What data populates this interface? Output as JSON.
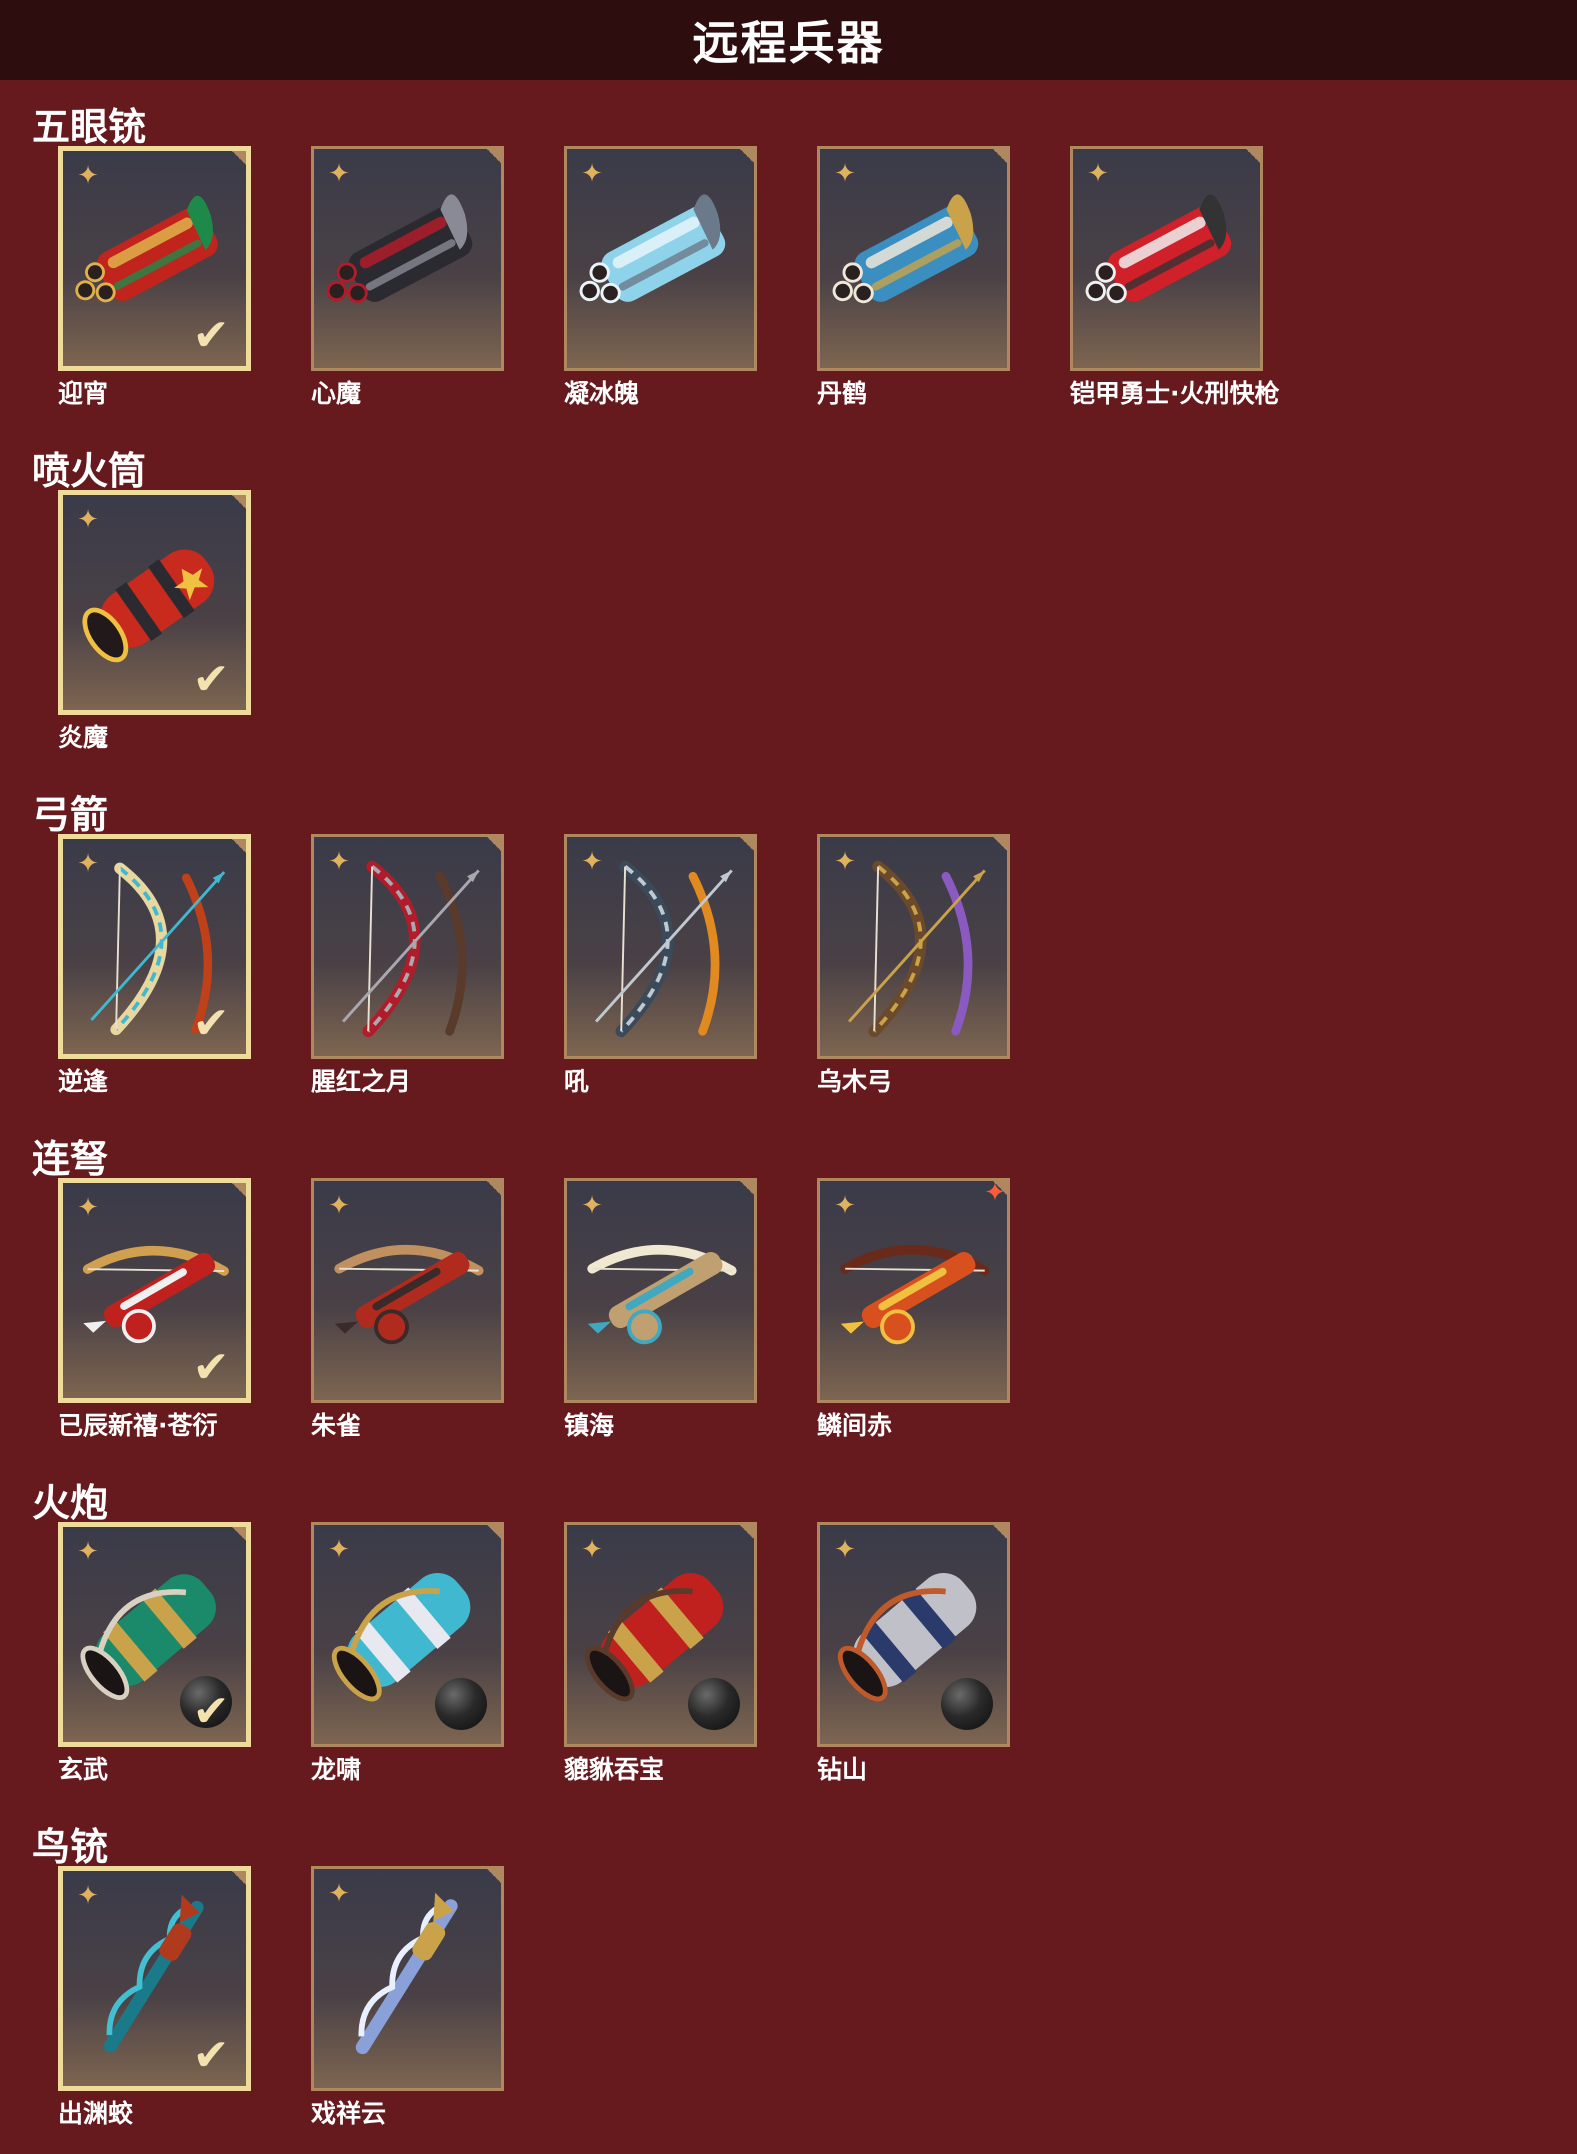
{
  "header": {
    "title": "远程兵器"
  },
  "sections": [
    {
      "title": "五眼铳",
      "items": [
        {
          "name": "迎宵",
          "equipped": true,
          "palette": [
            "#c0241d",
            "#e0b14a",
            "#1d8a4a"
          ],
          "icon": "multi-barrel-gun"
        },
        {
          "name": "心魔",
          "equipped": false,
          "palette": [
            "#2a2a30",
            "#b01c2a",
            "#8a8a96"
          ],
          "icon": "multi-barrel-gun"
        },
        {
          "name": "凝冰魄",
          "equipped": false,
          "palette": [
            "#8fd3ea",
            "#e8f4fa",
            "#6a7a8a"
          ],
          "icon": "multi-barrel-gun"
        },
        {
          "name": "丹鹤",
          "equipped": false,
          "palette": [
            "#3a8fc0",
            "#eee8d8",
            "#c9a24a"
          ],
          "icon": "multi-barrel-gun"
        },
        {
          "name": "铠甲勇士·火刑快枪",
          "equipped": false,
          "palette": [
            "#d0202a",
            "#f0f0f0",
            "#333333"
          ],
          "icon": "multi-barrel-gun"
        }
      ]
    },
    {
      "title": "喷火筒",
      "items": [
        {
          "name": "炎魔",
          "equipped": true,
          "palette": [
            "#c82a1e",
            "#f0c040",
            "#2a2a30"
          ],
          "icon": "flame-tube"
        }
      ]
    },
    {
      "title": "弓箭",
      "items": [
        {
          "name": "逆逢",
          "equipped": true,
          "palette": [
            "#e8d8a0",
            "#40b8d0",
            "#c0401a"
          ],
          "icon": "bow"
        },
        {
          "name": "腥红之月",
          "equipped": false,
          "palette": [
            "#b01c2a",
            "#a8a8b0",
            "#5a3a2a"
          ],
          "icon": "bow"
        },
        {
          "name": "吼",
          "equipped": false,
          "palette": [
            "#3a4a5a",
            "#c0c8d0",
            "#e08a20"
          ],
          "icon": "bow"
        },
        {
          "name": "乌木弓",
          "equipped": false,
          "palette": [
            "#6a4a2a",
            "#c9a24a",
            "#8a5ac0"
          ],
          "icon": "bow"
        }
      ]
    },
    {
      "title": "连弩",
      "items": [
        {
          "name": "已辰新禧·苍衍",
          "equipped": true,
          "new": false,
          "palette": [
            "#c0201e",
            "#f0f0f0",
            "#d0a050"
          ],
          "icon": "crossbow"
        },
        {
          "name": "朱雀",
          "equipped": false,
          "new": false,
          "palette": [
            "#b02a1e",
            "#3a2a2a",
            "#c09060"
          ],
          "icon": "crossbow"
        },
        {
          "name": "镇海",
          "equipped": false,
          "new": false,
          "palette": [
            "#c0a070",
            "#40a8c0",
            "#f0e8d0"
          ],
          "icon": "crossbow"
        },
        {
          "name": "鳞间赤",
          "equipped": false,
          "new": true,
          "palette": [
            "#d8501e",
            "#f0c040",
            "#6a2a1a"
          ],
          "icon": "crossbow"
        }
      ]
    },
    {
      "title": "火炮",
      "items": [
        {
          "name": "玄武",
          "equipped": true,
          "palette": [
            "#1a8a6a",
            "#c9a24a",
            "#d8d0c0"
          ],
          "icon": "cannon",
          "ammo": true
        },
        {
          "name": "龙啸",
          "equipped": false,
          "palette": [
            "#40b8d0",
            "#e8e8f0",
            "#c9a24a"
          ],
          "icon": "cannon",
          "ammo": true
        },
        {
          "name": "貔貅吞宝",
          "equipped": false,
          "palette": [
            "#c0201e",
            "#c9a24a",
            "#5a3a2a"
          ],
          "icon": "cannon",
          "ammo": true
        },
        {
          "name": "钻山",
          "equipped": false,
          "palette": [
            "#c0c0c8",
            "#2a3a6a",
            "#c05a2a"
          ],
          "icon": "cannon",
          "ammo": true
        }
      ]
    },
    {
      "title": "鸟铳",
      "items": [
        {
          "name": "出渊蛟",
          "equipped": true,
          "palette": [
            "#1a7a8a",
            "#40c0d0",
            "#b03a1e"
          ],
          "icon": "musket"
        },
        {
          "name": "戏祥云",
          "equipped": false,
          "palette": [
            "#8aa0d8",
            "#e8f0ff",
            "#c9a24a"
          ],
          "icon": "musket"
        }
      ]
    }
  ],
  "icons": {
    "rarity": "✦",
    "equipped": "✔",
    "new": "✦"
  },
  "colors": {
    "background": "#661a1e",
    "header": "#2e0d0f",
    "tile_border": "#b08860",
    "equipped_border": "#eedb9a",
    "rarity_icon": "#e1b25d"
  }
}
